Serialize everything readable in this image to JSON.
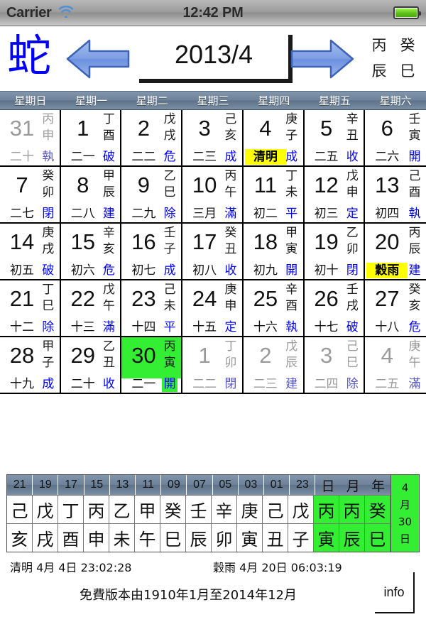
{
  "status_bar": {
    "carrier": "Carrier",
    "time": "12:42 PM",
    "wifi_icon": "wifi-icon",
    "battery_icon": "battery-icon"
  },
  "nav": {
    "zodiac": "蛇",
    "prev_icon": "left-arrow-icon",
    "next_icon": "right-arrow-icon",
    "year_month": "2013/4",
    "stem_branch": [
      "丙",
      "癸",
      "辰",
      "巳"
    ]
  },
  "colors": {
    "header_blue": "#6c819a",
    "term_highlight": "#ffff00",
    "today_green": "#33ee33",
    "jx_blue": "#0000ff",
    "zodiac_blue": "#0000ff"
  },
  "weekdays": [
    "星期日",
    "星期一",
    "星期二",
    "星期三",
    "星期四",
    "星期五",
    "星期六"
  ],
  "days": [
    {
      "d": "31",
      "gz": [
        "丙",
        "申"
      ],
      "lunar": "二十",
      "jx": "執",
      "other": true,
      "term": false,
      "sel": false
    },
    {
      "d": "1",
      "gz": [
        "丁",
        "酉"
      ],
      "lunar": "二一",
      "jx": "破",
      "other": false,
      "term": false,
      "sel": false
    },
    {
      "d": "2",
      "gz": [
        "戊",
        "戌"
      ],
      "lunar": "二二",
      "jx": "危",
      "other": false,
      "term": false,
      "sel": false
    },
    {
      "d": "3",
      "gz": [
        "己",
        "亥"
      ],
      "lunar": "二三",
      "jx": "成",
      "other": false,
      "term": false,
      "sel": false
    },
    {
      "d": "4",
      "gz": [
        "庚",
        "子"
      ],
      "lunar": "清明",
      "jx": "成",
      "other": false,
      "term": true,
      "sel": false
    },
    {
      "d": "5",
      "gz": [
        "辛",
        "丑"
      ],
      "lunar": "二五",
      "jx": "收",
      "other": false,
      "term": false,
      "sel": false
    },
    {
      "d": "6",
      "gz": [
        "壬",
        "寅"
      ],
      "lunar": "二六",
      "jx": "開",
      "other": false,
      "term": false,
      "sel": false
    },
    {
      "d": "7",
      "gz": [
        "癸",
        "卯"
      ],
      "lunar": "二七",
      "jx": "閉",
      "other": false,
      "term": false,
      "sel": false
    },
    {
      "d": "8",
      "gz": [
        "甲",
        "辰"
      ],
      "lunar": "二八",
      "jx": "建",
      "other": false,
      "term": false,
      "sel": false
    },
    {
      "d": "9",
      "gz": [
        "乙",
        "巳"
      ],
      "lunar": "二九",
      "jx": "除",
      "other": false,
      "term": false,
      "sel": false
    },
    {
      "d": "10",
      "gz": [
        "丙",
        "午"
      ],
      "lunar": "三月",
      "jx": "滿",
      "other": false,
      "term": false,
      "sel": false
    },
    {
      "d": "11",
      "gz": [
        "丁",
        "未"
      ],
      "lunar": "初二",
      "jx": "平",
      "other": false,
      "term": false,
      "sel": false
    },
    {
      "d": "12",
      "gz": [
        "戊",
        "申"
      ],
      "lunar": "初三",
      "jx": "定",
      "other": false,
      "term": false,
      "sel": false
    },
    {
      "d": "13",
      "gz": [
        "己",
        "酉"
      ],
      "lunar": "初四",
      "jx": "執",
      "other": false,
      "term": false,
      "sel": false
    },
    {
      "d": "14",
      "gz": [
        "庚",
        "戌"
      ],
      "lunar": "初五",
      "jx": "破",
      "other": false,
      "term": false,
      "sel": false
    },
    {
      "d": "15",
      "gz": [
        "辛",
        "亥"
      ],
      "lunar": "初六",
      "jx": "危",
      "other": false,
      "term": false,
      "sel": false
    },
    {
      "d": "16",
      "gz": [
        "壬",
        "子"
      ],
      "lunar": "初七",
      "jx": "成",
      "other": false,
      "term": false,
      "sel": false
    },
    {
      "d": "17",
      "gz": [
        "癸",
        "丑"
      ],
      "lunar": "初八",
      "jx": "收",
      "other": false,
      "term": false,
      "sel": false
    },
    {
      "d": "18",
      "gz": [
        "甲",
        "寅"
      ],
      "lunar": "初九",
      "jx": "開",
      "other": false,
      "term": false,
      "sel": false
    },
    {
      "d": "19",
      "gz": [
        "乙",
        "卯"
      ],
      "lunar": "初十",
      "jx": "閉",
      "other": false,
      "term": false,
      "sel": false
    },
    {
      "d": "20",
      "gz": [
        "丙",
        "辰"
      ],
      "lunar": "穀雨",
      "jx": "建",
      "other": false,
      "term": true,
      "sel": false
    },
    {
      "d": "21",
      "gz": [
        "丁",
        "巳"
      ],
      "lunar": "十二",
      "jx": "除",
      "other": false,
      "term": false,
      "sel": false
    },
    {
      "d": "22",
      "gz": [
        "戊",
        "午"
      ],
      "lunar": "十三",
      "jx": "滿",
      "other": false,
      "term": false,
      "sel": false
    },
    {
      "d": "23",
      "gz": [
        "己",
        "未"
      ],
      "lunar": "十四",
      "jx": "平",
      "other": false,
      "term": false,
      "sel": false
    },
    {
      "d": "24",
      "gz": [
        "庚",
        "申"
      ],
      "lunar": "十五",
      "jx": "定",
      "other": false,
      "term": false,
      "sel": false
    },
    {
      "d": "25",
      "gz": [
        "辛",
        "酉"
      ],
      "lunar": "十六",
      "jx": "執",
      "other": false,
      "term": false,
      "sel": false
    },
    {
      "d": "26",
      "gz": [
        "壬",
        "戌"
      ],
      "lunar": "十七",
      "jx": "破",
      "other": false,
      "term": false,
      "sel": false
    },
    {
      "d": "27",
      "gz": [
        "癸",
        "亥"
      ],
      "lunar": "十八",
      "jx": "危",
      "other": false,
      "term": false,
      "sel": false
    },
    {
      "d": "28",
      "gz": [
        "甲",
        "子"
      ],
      "lunar": "十九",
      "jx": "成",
      "other": false,
      "term": false,
      "sel": false
    },
    {
      "d": "29",
      "gz": [
        "乙",
        "丑"
      ],
      "lunar": "二十",
      "jx": "收",
      "other": false,
      "term": false,
      "sel": false
    },
    {
      "d": "30",
      "gz": [
        "丙",
        "寅"
      ],
      "lunar": "二一",
      "jx": "開",
      "other": false,
      "term": false,
      "sel": true
    },
    {
      "d": "1",
      "gz": [
        "丁",
        "卯"
      ],
      "lunar": "二二",
      "jx": "閉",
      "other": true,
      "term": false,
      "sel": false
    },
    {
      "d": "2",
      "gz": [
        "戊",
        "辰"
      ],
      "lunar": "二三",
      "jx": "建",
      "other": true,
      "term": false,
      "sel": false
    },
    {
      "d": "3",
      "gz": [
        "己",
        "巳"
      ],
      "lunar": "二四",
      "jx": "除",
      "other": true,
      "term": false,
      "sel": false
    },
    {
      "d": "4",
      "gz": [
        "庚",
        "午"
      ],
      "lunar": "二五",
      "jx": "滿",
      "other": true,
      "term": false,
      "sel": false
    }
  ],
  "sb_panel": {
    "hour_headers": [
      "21",
      "19",
      "17",
      "15",
      "13",
      "11",
      "09",
      "07",
      "05",
      "03",
      "01",
      "23"
    ],
    "pillar_headers": [
      "日",
      "月",
      "年"
    ],
    "stems": [
      "己",
      "戊",
      "丁",
      "丙",
      "乙",
      "甲",
      "癸",
      "壬",
      "辛",
      "庚",
      "己",
      "戊"
    ],
    "branches": [
      "亥",
      "戌",
      "酉",
      "申",
      "未",
      "午",
      "巳",
      "辰",
      "卯",
      "寅",
      "丑",
      "子"
    ],
    "pillar_stems": [
      "丙",
      "丙",
      "癸"
    ],
    "pillar_branches": [
      "寅",
      "辰",
      "巳"
    ],
    "today_label": [
      "4",
      "月",
      "30",
      "日"
    ]
  },
  "footer": {
    "term_prev": "清明 4月 4日  23:02:28",
    "term_next": "穀雨 4月 20日  06:03:19",
    "free_note": "免費版本由1910年1月至2014年12月",
    "info_label": "info"
  }
}
